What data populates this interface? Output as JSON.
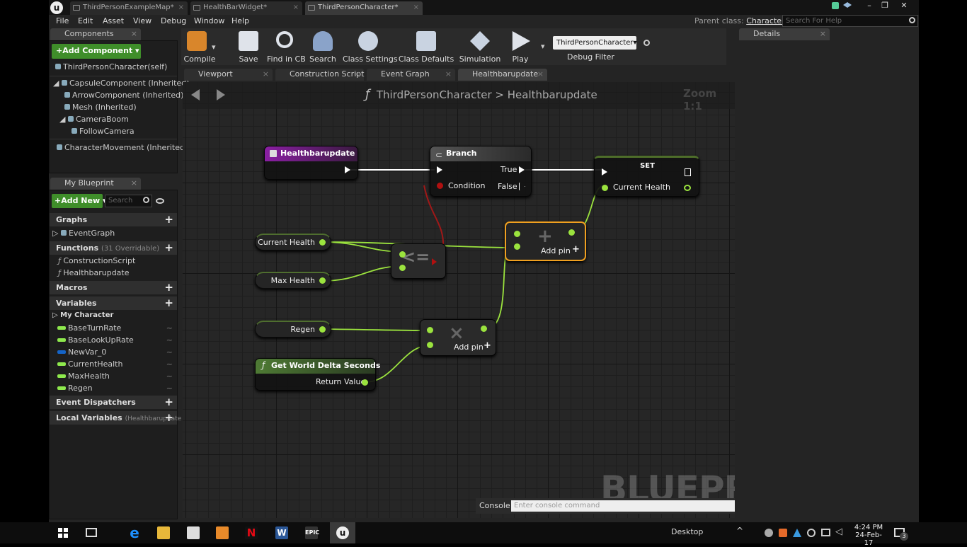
{
  "doc_tabs": [
    {
      "label": "ThirdPersonExampleMap*"
    },
    {
      "label": "HealthBarWidget*"
    },
    {
      "label": "ThirdPersonCharacter*"
    }
  ],
  "menu": [
    "File",
    "Edit",
    "Asset",
    "View",
    "Debug",
    "Window",
    "Help"
  ],
  "parent_class": {
    "label": "Parent class:",
    "value": "Character"
  },
  "help_search": {
    "placeholder": "Search For Help"
  },
  "components": {
    "tab": "Components",
    "add_button": "+Add Component ▾",
    "self": "ThirdPersonCharacter(self)",
    "items": [
      "CapsuleComponent (Inherited)",
      "ArrowComponent (Inherited)",
      "Mesh (Inherited)",
      "CameraBoom",
      "FollowCamera",
      "CharacterMovement (Inherited)"
    ]
  },
  "my_blueprint": {
    "tab": "My Blueprint",
    "add_new": "+Add New ▾",
    "search_placeholder": "Search",
    "graphs_label": "Graphs",
    "event_graph": "EventGraph",
    "functions_label": "Functions",
    "functions_hint": "(31 Overridable)",
    "functions": [
      "ConstructionScript",
      "Healthbarupdate"
    ],
    "macros_label": "Macros",
    "variables_label": "Variables",
    "my_character": "My Character",
    "variables": [
      {
        "name": "BaseTurnRate",
        "color": "#8ee94d"
      },
      {
        "name": "BaseLookUpRate",
        "color": "#8ee94d"
      },
      {
        "name": "NewVar_0",
        "color": "#1464c8"
      },
      {
        "name": "CurrentHealth",
        "color": "#8ee94d"
      },
      {
        "name": "MaxHealth",
        "color": "#8ee94d"
      },
      {
        "name": "Regen",
        "color": "#8ee94d"
      }
    ],
    "dispatchers_label": "Event Dispatchers",
    "local_vars_label": "Local Variables",
    "local_vars_hint": "(Healthbarupdate"
  },
  "toolbar": {
    "compile": "Compile",
    "save": "Save",
    "find_in_cb": "Find in CB",
    "search": "Search",
    "class_settings": "Class Settings",
    "class_defaults": "Class Defaults",
    "simulation": "Simulation",
    "play": "Play",
    "debug_filter_value": "ThirdPersonCharacter▾",
    "debug_filter_label": "Debug Filter"
  },
  "graph_tabs": [
    "Viewport",
    "Construction Script",
    "Event Graph",
    "Healthbarupdate"
  ],
  "breadcrumb": {
    "root": "ThirdPersonCharacter",
    "sep": ">",
    "leaf": "Healthbarupdate"
  },
  "zoom": "Zoom 1:1",
  "watermark": "BLUEPRINT",
  "nodes": {
    "entry": "Healthbarupdate",
    "branch": "Branch",
    "branch_true": "True",
    "branch_false": "False",
    "branch_cond": "Condition",
    "set": "SET",
    "set_pin": "Current Health",
    "get_current": "Current Health",
    "get_max": "Max Health",
    "get_regen": "Regen",
    "compare": "<=",
    "add": "+",
    "add_pin": "Add pin",
    "multiply": "×",
    "delta": "Get World Delta Seconds",
    "delta_pin": "Return Value"
  },
  "console": {
    "label": "Console",
    "placeholder": "Enter console command"
  },
  "details": {
    "tab": "Details"
  },
  "taskbar": {
    "desktop": "Desktop",
    "time": "4:24 PM",
    "date": "24-Feb-17",
    "notif": "3"
  }
}
